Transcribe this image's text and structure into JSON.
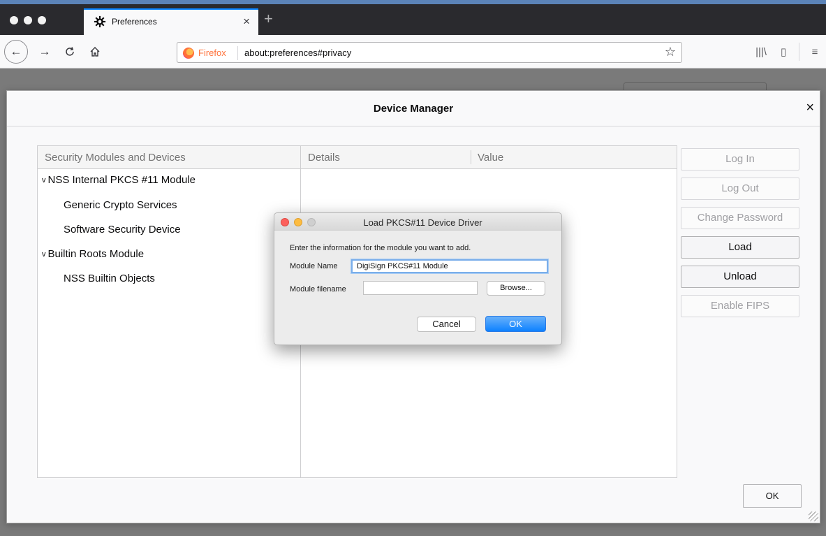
{
  "browser": {
    "tab": {
      "title": "Preferences",
      "icon": "gear-icon",
      "close_glyph": "×"
    },
    "new_tab_glyph": "+",
    "url_bar": {
      "identity_label": "Firefox",
      "url": "about:preferences#privacy"
    },
    "nav": {
      "back_glyph": "←",
      "forward_glyph": "→",
      "reload_glyph": "C",
      "home_glyph": "⌂",
      "star_glyph": "☆",
      "library_glyph": "|||\\",
      "sidebar_glyph": "▯",
      "menu_glyph": "≡"
    }
  },
  "device_manager": {
    "title": "Device Manager",
    "close_glyph": "×",
    "tree": {
      "header": "Security Modules and Devices",
      "twisty_glyph": "v",
      "items": [
        {
          "label": "NSS Internal PKCS #11 Module",
          "level": 0
        },
        {
          "label": "Generic Crypto Services",
          "level": 1
        },
        {
          "label": "Software Security Device",
          "level": 1
        },
        {
          "label": "Builtin Roots Module",
          "level": 0
        },
        {
          "label": "NSS Builtin Objects",
          "level": 1
        }
      ]
    },
    "details": {
      "col_details": "Details",
      "col_value": "Value"
    },
    "buttons": {
      "log_in": "Log In",
      "log_out": "Log Out",
      "change_password": "Change Password",
      "load": "Load",
      "unload": "Unload",
      "enable_fips": "Enable FIPS"
    },
    "ok": "OK"
  },
  "load_dialog": {
    "title": "Load PKCS#11 Device Driver",
    "description": "Enter the information for the module you want to add.",
    "module_name_label": "Module Name",
    "module_name_value": "DigiSign PKCS#11 Module",
    "module_filename_label": "Module filename",
    "module_filename_value": "",
    "browse": "Browse...",
    "cancel": "Cancel",
    "ok": "OK"
  },
  "colors": {
    "accent": "#0a84ff",
    "firefox_orange": "#ff7139",
    "mac_close": "#fc605c",
    "mac_minimize": "#fdbc40",
    "mac_zoom_disabled": "#cfcfcf"
  }
}
